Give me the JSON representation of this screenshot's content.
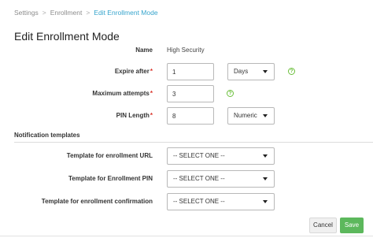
{
  "breadcrumb": {
    "items": [
      "Settings",
      "Enrollment"
    ],
    "separator": ">",
    "current": "Edit Enrollment Mode"
  },
  "page": {
    "title": "Edit Enrollment Mode"
  },
  "form": {
    "name": {
      "label": "Name",
      "value": "High Security"
    },
    "expire_after": {
      "label": "Expire after",
      "required": "*",
      "value": "1",
      "unit": "Days",
      "help_icon": "question-circle-icon"
    },
    "maximum_attempts": {
      "label": "Maximum attempts",
      "required": "*",
      "value": "3",
      "help_icon": "question-circle-icon"
    },
    "pin_length": {
      "label": "PIN Length",
      "required": "*",
      "value": "8",
      "type": "Numeric"
    }
  },
  "notifications": {
    "title": "Notification templates",
    "url": {
      "label": "Template for enrollment URL",
      "value": "-- SELECT ONE --"
    },
    "pin": {
      "label": "Template for Enrollment PIN",
      "value": "-- SELECT ONE --"
    },
    "confirmation": {
      "label": "Template for enrollment confirmation",
      "value": "-- SELECT ONE --"
    }
  },
  "actions": {
    "cancel": "Cancel",
    "save": "Save"
  },
  "colors": {
    "accent": "#36a4cc",
    "required": "#d9342b",
    "help": "#6bbf3b",
    "save": "#5cb85c"
  }
}
